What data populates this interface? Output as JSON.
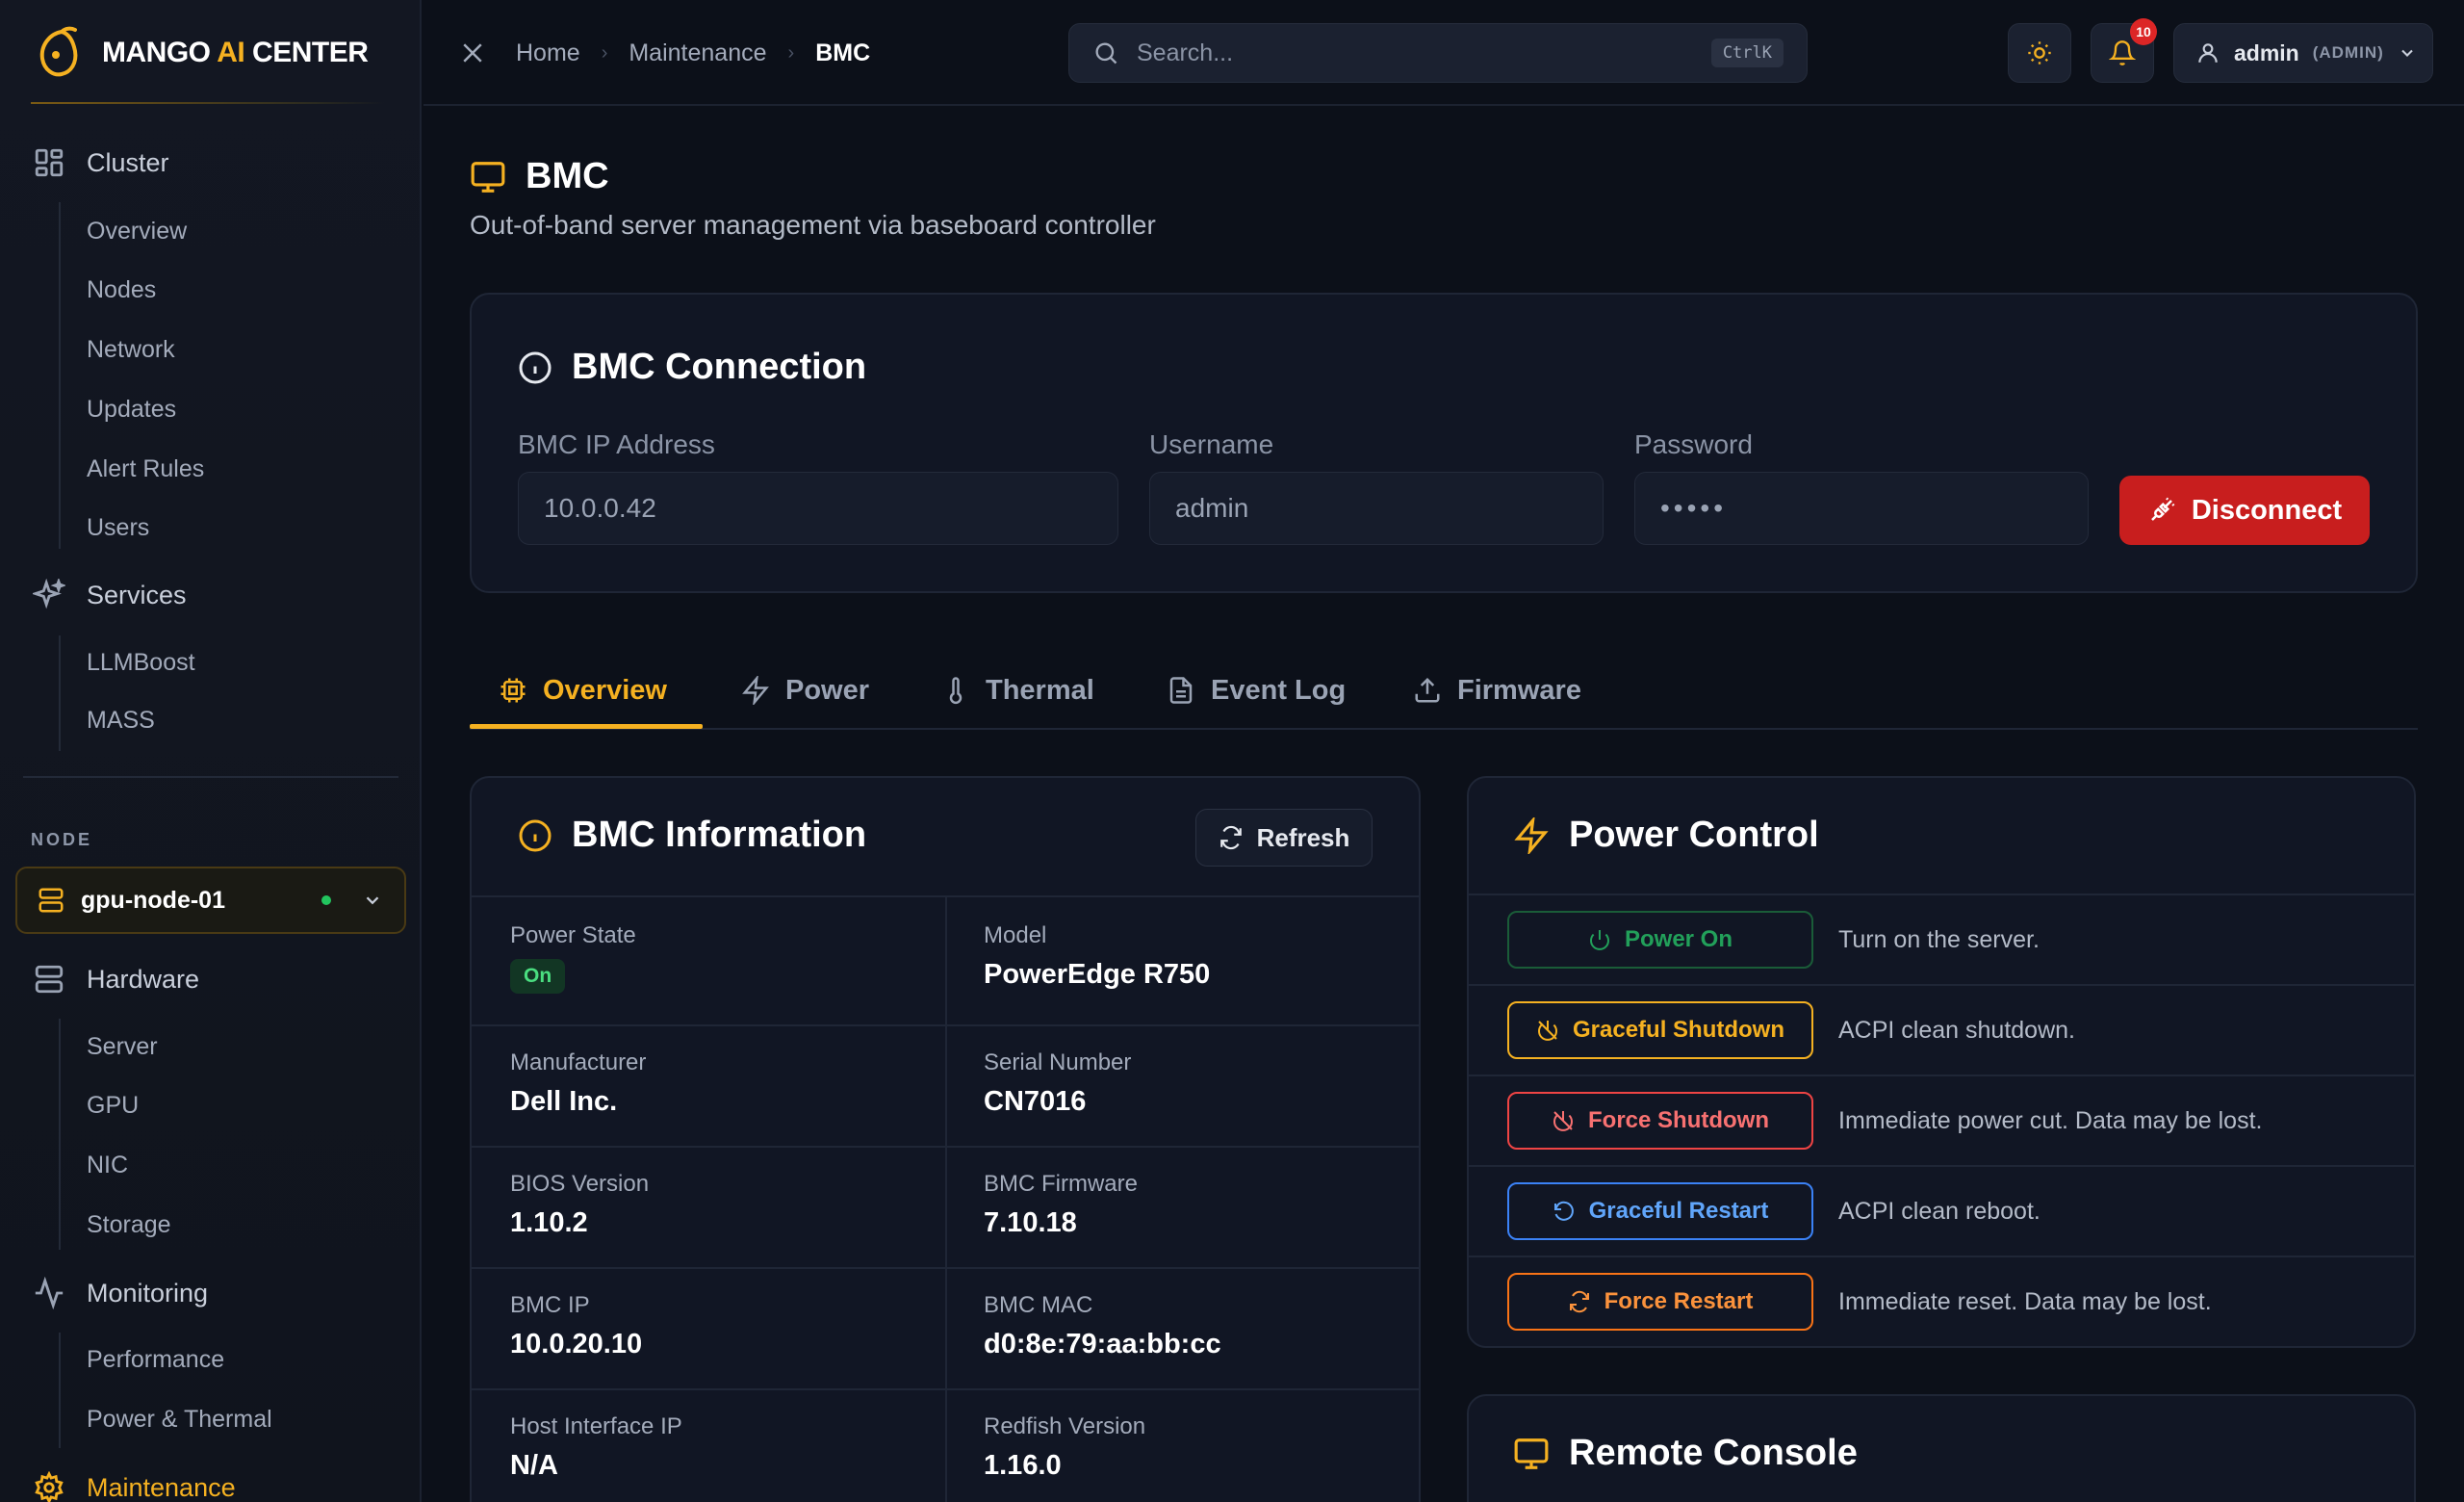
{
  "brand": {
    "name_part1": "MANGO ",
    "name_ai": "AI",
    "name_part2": " CENTER"
  },
  "sidebar": {
    "cluster": {
      "label": "Cluster",
      "items": [
        "Overview",
        "Nodes",
        "Network",
        "Updates",
        "Alert Rules",
        "Users"
      ]
    },
    "services": {
      "label": "Services",
      "items": [
        "LLMBoost",
        "MASS"
      ]
    },
    "node_label": "NODE",
    "node_select": "gpu-node-01",
    "hardware": {
      "label": "Hardware",
      "items": [
        "Server",
        "GPU",
        "NIC",
        "Storage"
      ]
    },
    "monitoring": {
      "label": "Monitoring",
      "items": [
        "Performance",
        "Power & Thermal"
      ]
    },
    "maintenance": {
      "label": "Maintenance"
    }
  },
  "topbar": {
    "breadcrumbs": [
      "Home",
      "Maintenance",
      "BMC"
    ],
    "search_placeholder": "Search...",
    "search_shortcut": "CtrlK",
    "notification_count": "10",
    "user": "admin",
    "role": "(ADMIN)"
  },
  "page": {
    "title": "BMC",
    "subtitle": "Out-of-band server management via baseboard controller"
  },
  "connection": {
    "title": "BMC Connection",
    "ip_label": "BMC IP Address",
    "ip_value": "10.0.0.42",
    "username_label": "Username",
    "username_value": "admin",
    "password_label": "Password",
    "password_value": "•••••",
    "disconnect_label": "Disconnect"
  },
  "tabs": [
    "Overview",
    "Power",
    "Thermal",
    "Event Log",
    "Firmware"
  ],
  "bmc_info": {
    "title": "BMC Information",
    "refresh_label": "Refresh",
    "fields": [
      {
        "label": "Power State",
        "value": "On"
      },
      {
        "label": "Model",
        "value": "PowerEdge R750"
      },
      {
        "label": "Manufacturer",
        "value": "Dell Inc."
      },
      {
        "label": "Serial Number",
        "value": "CN7016"
      },
      {
        "label": "BIOS Version",
        "value": "1.10.2"
      },
      {
        "label": "BMC Firmware",
        "value": "7.10.18"
      },
      {
        "label": "BMC IP",
        "value": "10.0.20.10"
      },
      {
        "label": "BMC MAC",
        "value": "d0:8e:79:aa:bb:cc"
      },
      {
        "label": "Host Interface IP",
        "value": "N/A"
      },
      {
        "label": "Redfish Version",
        "value": "1.16.0"
      }
    ]
  },
  "power_control": {
    "title": "Power Control",
    "actions": [
      {
        "label": "Power On",
        "desc": "Turn on the server.",
        "color": "#22a05a"
      },
      {
        "label": "Graceful Shutdown",
        "desc": "ACPI clean shutdown.",
        "color": "#f5b121"
      },
      {
        "label": "Force Shutdown",
        "desc": "Immediate power cut. Data may be lost.",
        "color": "#ef4444"
      },
      {
        "label": "Graceful Restart",
        "desc": "ACPI clean reboot.",
        "color": "#3b82f6"
      },
      {
        "label": "Force Restart",
        "desc": "Immediate reset. Data may be lost.",
        "color": "#f97316"
      }
    ]
  },
  "remote_console": {
    "title": "Remote Console"
  }
}
